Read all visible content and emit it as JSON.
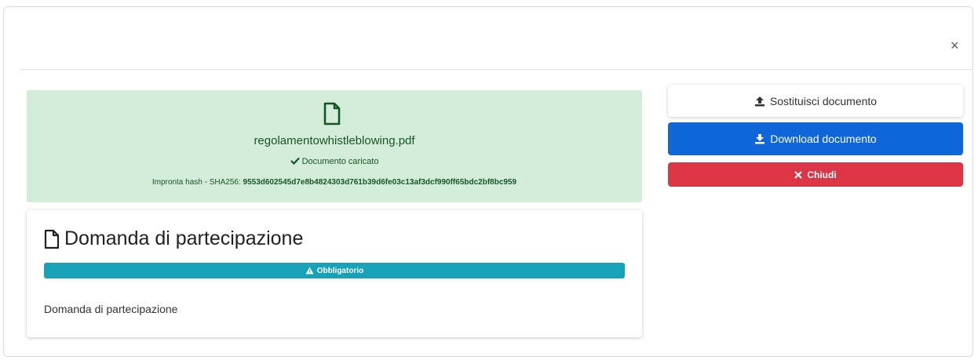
{
  "dialog": {
    "close_symbol": "×"
  },
  "uploaded": {
    "filename": "regolamentowhistleblowing.pdf",
    "status": "Documento caricato",
    "hash_label": "Impronta hash - SHA256:",
    "hash_value": "9553d602545d7e8b4824303d761b39d6fe03c13af3dcf990ff65bdc2bf8bc959",
    "icons": [
      "file-icon",
      "check-icon"
    ],
    "color": "#155724"
  },
  "document": {
    "title": "Domanda di partecipazione",
    "badge": "Obbligatorio",
    "description": "Domanda di partecipazione",
    "icons": [
      "file-icon",
      "warning-icon"
    ]
  },
  "actions": {
    "replace_label": "Sostituisci documento",
    "download_label": "Download documento",
    "close_label": "Chiudi",
    "icons": [
      "upload-icon",
      "download-icon",
      "x-icon"
    ]
  },
  "colors": {
    "success_bg": "#d4edda",
    "info": "#17a2b8",
    "primary": "#0f66d8",
    "danger": "#dc3545"
  }
}
